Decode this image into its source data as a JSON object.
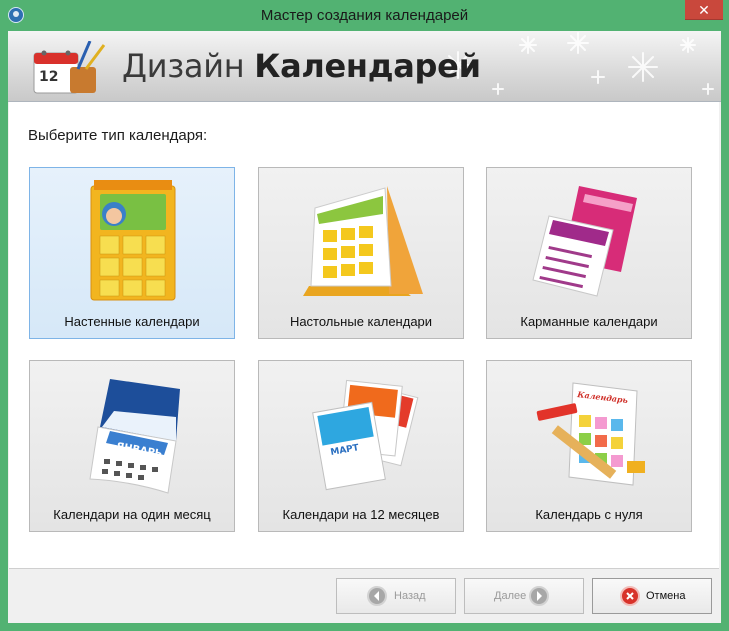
{
  "window": {
    "title": "Мастер создания календарей",
    "close_glyph": "✕"
  },
  "header": {
    "title_light": "Дизайн",
    "title_bold": "Календарей",
    "icon_day": "12"
  },
  "prompt": "Выберите тип календаря:",
  "tiles": [
    {
      "label": "Настенные календари",
      "icon": "wall-calendar-icon",
      "selected": true
    },
    {
      "label": "Настольные календари",
      "icon": "desk-calendar-icon",
      "selected": false
    },
    {
      "label": "Карманные календари",
      "icon": "pocket-calendar-icon",
      "selected": false
    },
    {
      "label": "Календари на один месяц",
      "icon": "monthly-calendar-icon",
      "selected": false,
      "art_text": "ЯНВАРЬ"
    },
    {
      "label": "Календари на 12 месяцев",
      "icon": "twelve-month-calendar-icon",
      "selected": false,
      "art_text": "МАРТ"
    },
    {
      "label": "Календарь с нуля",
      "icon": "blank-calendar-icon",
      "selected": false,
      "art_text": "Календарь"
    }
  ],
  "buttons": {
    "back": "Назад",
    "next": "Далее",
    "cancel": "Отмена"
  },
  "colors": {
    "frame": "#52b272",
    "selected_tile": "#d6e8f8",
    "cancel_icon": "#d8322a"
  }
}
